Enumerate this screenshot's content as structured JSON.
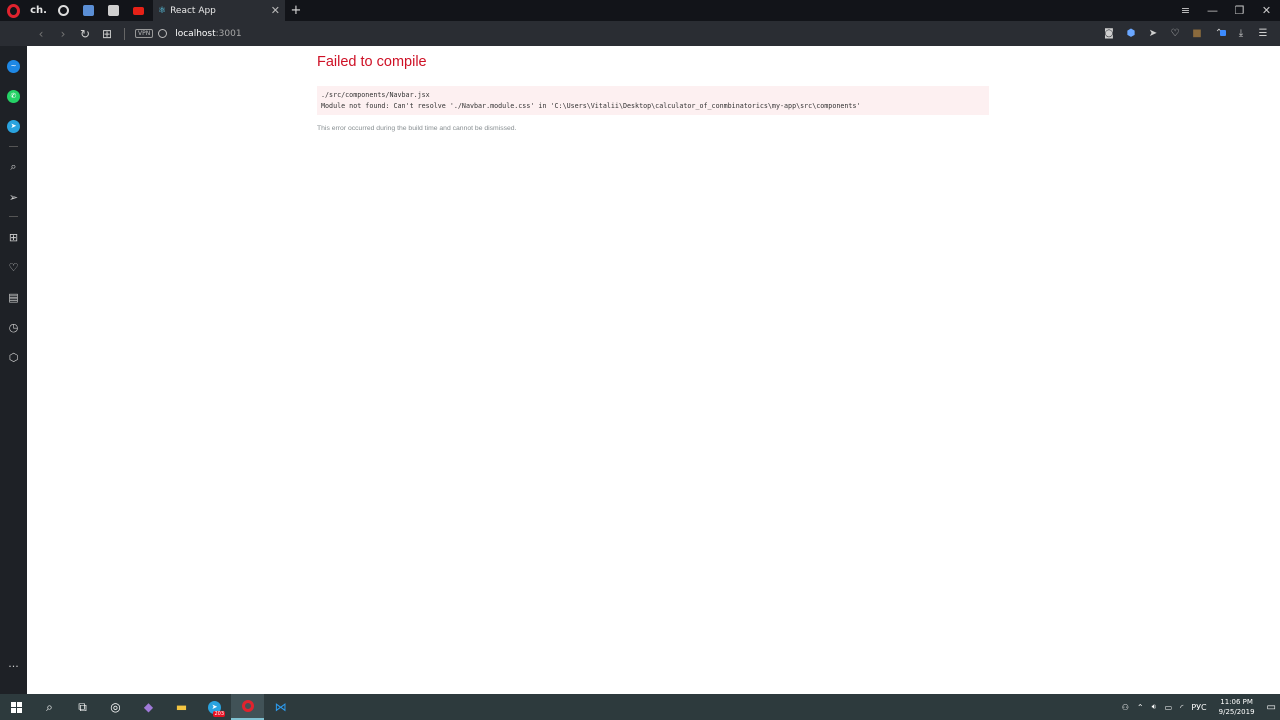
{
  "browser": {
    "pinned_tab_label": "ch.",
    "active_tab": {
      "title": "React App"
    },
    "address": {
      "host": "localhost",
      "port": ":3001",
      "vpn_label": "VPN"
    }
  },
  "page": {
    "error_title": "Failed to compile",
    "error_file": "./src/components/Navbar.jsx",
    "error_message": "Module not found: Can't resolve './Navbar.module.css' in 'C:\\Users\\Vitalii\\Desktop\\calculator_of_conmbinatorics\\my-app\\src\\components'",
    "error_note": "This error occurred during the build time and cannot be dismissed."
  },
  "taskbar": {
    "telegram_badge": "203",
    "language": "РУС",
    "time": "11:06 PM",
    "date": "9/25/2019"
  },
  "colors": {
    "error_red": "#ce1126",
    "error_bg": "#fdf0f1",
    "note_gray": "#878e91"
  }
}
